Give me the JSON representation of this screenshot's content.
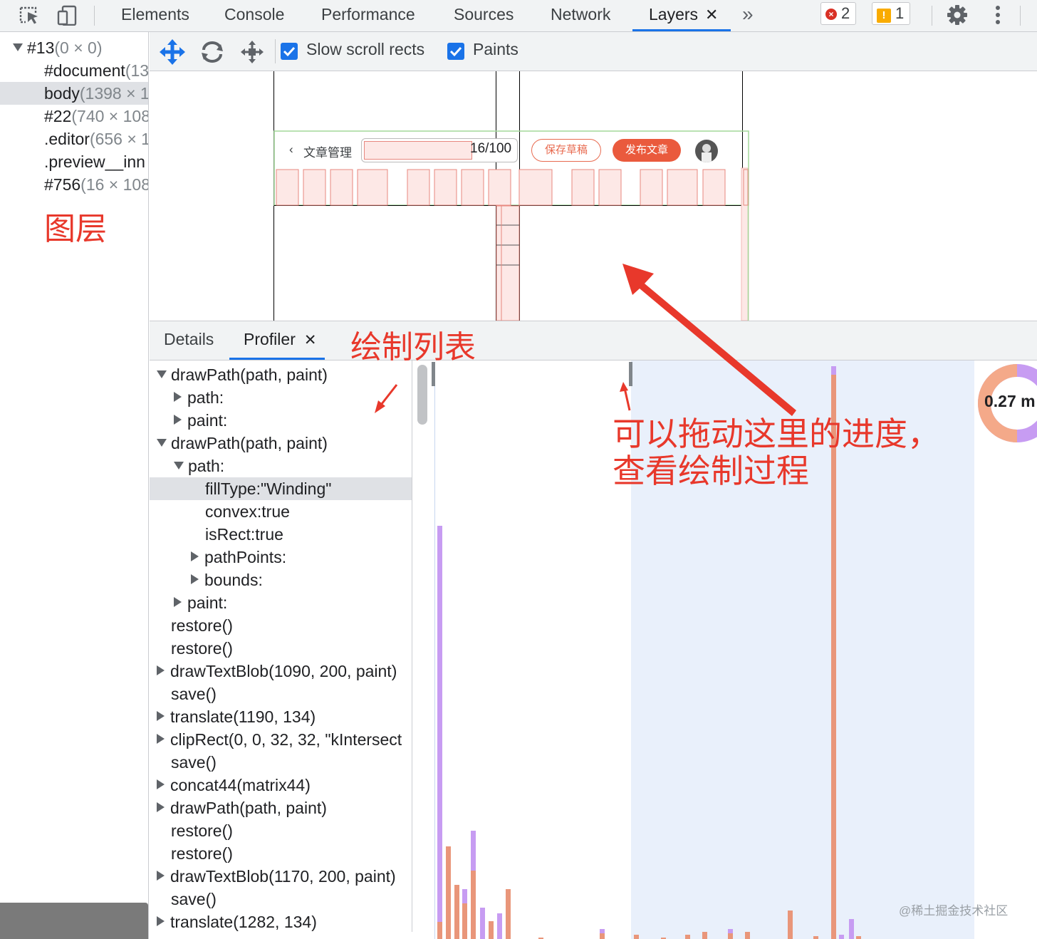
{
  "toolbar": {
    "tabs": [
      "Elements",
      "Console",
      "Performance",
      "Sources",
      "Network",
      "Layers"
    ],
    "overflow_glyph": "»",
    "close_glyph": "✕",
    "error_count": "2",
    "warning_count": "1",
    "icons": [
      "inspect-element-icon",
      "device-toolbar-icon",
      "gear-icon",
      "kebab-menu-icon"
    ]
  },
  "layer_tree": {
    "rows": [
      {
        "name": "#13",
        "dims": "(0 × 0)"
      },
      {
        "name": "#document",
        "dims": "(13"
      },
      {
        "name": "body",
        "dims": "(1398 × 1"
      },
      {
        "name": "#22",
        "dims": "(740 × 108"
      },
      {
        "name": ".editor",
        "dims": "(656 × 1"
      },
      {
        "name": ".preview__inn",
        "dims": ""
      },
      {
        "name": "#756",
        "dims": "(16 × 108"
      }
    ]
  },
  "layers_toolbar": {
    "slow_scroll_label": "Slow scroll rects",
    "paints_label": "Paints"
  },
  "preview": {
    "back_label": "文章管理",
    "counter": "16/100",
    "save_draft_label": "保存草稿",
    "publish_label": "发布文章"
  },
  "bottom_tabs": {
    "details": "Details",
    "profiler": "Profiler"
  },
  "command_log": [
    {
      "text": "drawPath(path, paint)",
      "indent": 0,
      "arrow": "down"
    },
    {
      "text": "path:",
      "indent": 1,
      "arrow": "right"
    },
    {
      "text": "paint:",
      "indent": 1,
      "arrow": "right"
    },
    {
      "text": "drawPath(path, paint)",
      "indent": 0,
      "arrow": "down"
    },
    {
      "text": "path:",
      "indent": 1,
      "arrow": "down"
    },
    {
      "text": "fillType:\"Winding\"",
      "indent": 2,
      "arrow": "none",
      "selected": true
    },
    {
      "text": "convex:true",
      "indent": 2,
      "arrow": "none"
    },
    {
      "text": "isRect:true",
      "indent": 2,
      "arrow": "none"
    },
    {
      "text": "pathPoints:",
      "indent": 2,
      "arrow": "right"
    },
    {
      "text": "bounds:",
      "indent": 2,
      "arrow": "right"
    },
    {
      "text": "paint:",
      "indent": 1,
      "arrow": "right"
    },
    {
      "text": "restore()",
      "indent": 0,
      "arrow": "none"
    },
    {
      "text": "restore()",
      "indent": 0,
      "arrow": "none"
    },
    {
      "text": "drawTextBlob(1090, 200, paint)",
      "indent": 0,
      "arrow": "right"
    },
    {
      "text": "save()",
      "indent": 0,
      "arrow": "none"
    },
    {
      "text": "translate(1190, 134)",
      "indent": 0,
      "arrow": "right"
    },
    {
      "text": "clipRect(0, 0, 32, 32, \"kIntersect",
      "indent": 0,
      "arrow": "right"
    },
    {
      "text": "save()",
      "indent": 0,
      "arrow": "none"
    },
    {
      "text": "concat44(matrix44)",
      "indent": 0,
      "arrow": "right"
    },
    {
      "text": "drawPath(path, paint)",
      "indent": 0,
      "arrow": "right"
    },
    {
      "text": "restore()",
      "indent": 0,
      "arrow": "none"
    },
    {
      "text": "restore()",
      "indent": 0,
      "arrow": "none"
    },
    {
      "text": "drawTextBlob(1170, 200, paint)",
      "indent": 0,
      "arrow": "right"
    },
    {
      "text": "save()",
      "indent": 0,
      "arrow": "none"
    },
    {
      "text": "translate(1282, 134)",
      "indent": 0,
      "arrow": "right"
    }
  ],
  "timeline": {
    "pie_label": "0.27 m",
    "colors": {
      "paint": "#e9967a",
      "raster": "#c79cf2",
      "selection": "#e9f0fb"
    }
  },
  "annotations": {
    "layers": "图层",
    "paint_list": "绘制列表",
    "drag_hint_line1": "可以拖动这里的进度，",
    "drag_hint_line2": "查看绘制过程",
    "watermark": "@稀土掘金技术社区"
  }
}
